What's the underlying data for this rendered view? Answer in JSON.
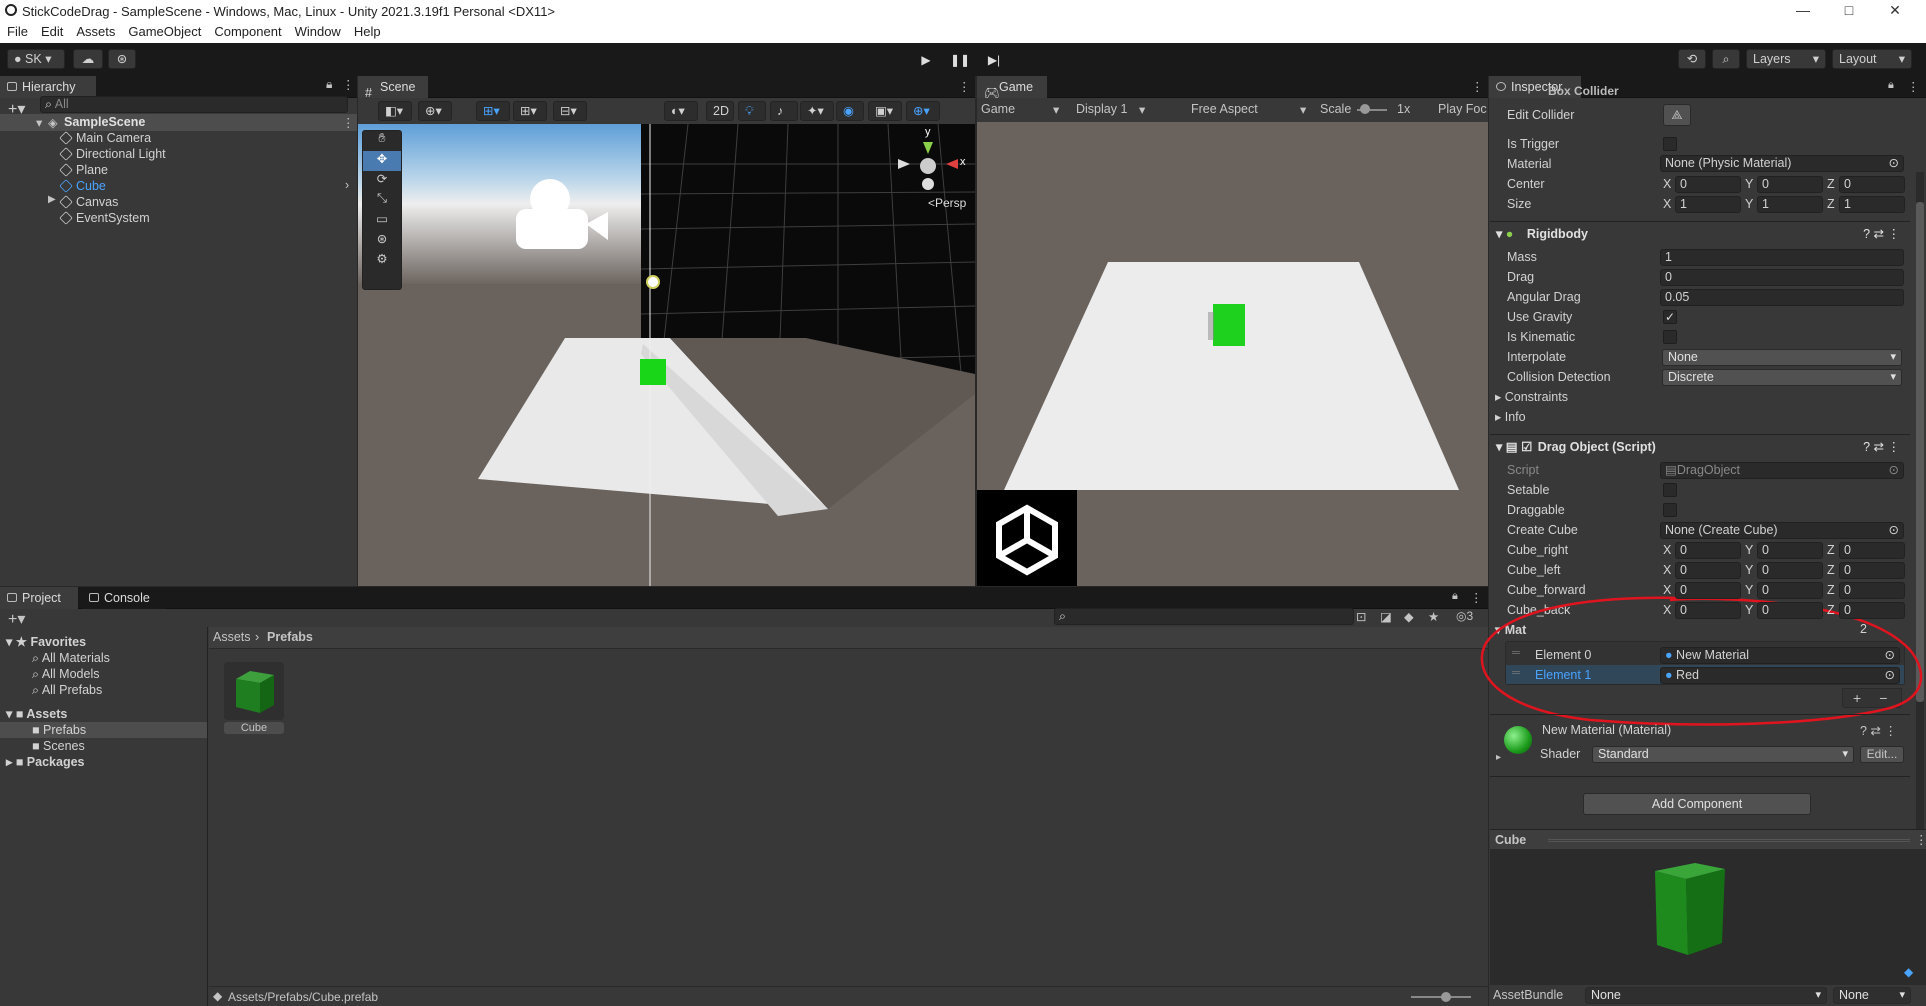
{
  "window": {
    "title": "StickCodeDrag - SampleScene - Windows, Mac, Linux - Unity 2021.3.19f1 Personal <DX11>",
    "minimize": "—",
    "maximize": "□",
    "close": "✕"
  },
  "menu": [
    "File",
    "Edit",
    "Assets",
    "GameObject",
    "Component",
    "Window",
    "Help"
  ],
  "toolbar": {
    "account": "SK",
    "layers": "Layers",
    "layout": "Layout"
  },
  "hierarchy": {
    "tab": "Hierarchy",
    "search_placeholder": "All",
    "scene": "SampleScene",
    "items": [
      "Main Camera",
      "Directional Light",
      "Plane",
      "Cube",
      "Canvas",
      "EventSystem"
    ]
  },
  "scene": {
    "tab": "Scene",
    "mode2d": "2D",
    "persp": "<Persp",
    "gizmo_y": "y",
    "gizmo_x": "x"
  },
  "game": {
    "tab": "Game",
    "display_mode": "Game",
    "display": "Display 1",
    "aspect": "Free Aspect",
    "scale_label": "Scale",
    "scale_value": "1x",
    "play_focused": "Play Foc"
  },
  "project": {
    "tabs": [
      "Project",
      "Console"
    ],
    "favorites": "Favorites",
    "fav_items": [
      "All Materials",
      "All Models",
      "All Prefabs"
    ],
    "assets": "Assets",
    "asset_folders": [
      "Prefabs",
      "Scenes"
    ],
    "packages": "Packages",
    "breadcrumb": [
      "Assets",
      "Prefabs"
    ],
    "files": [
      {
        "name": "Cube"
      }
    ],
    "status_path": "Assets/Prefabs/Cube.prefab",
    "hidden_count": "3"
  },
  "inspector": {
    "tab": "Inspector",
    "box_collider": {
      "header": "Box Collider",
      "edit_collider": "Edit Collider",
      "is_trigger": "Is Trigger",
      "material_label": "Material",
      "material_value": "None (Physic Material)",
      "center_label": "Center",
      "center": [
        "0",
        "0",
        "0"
      ],
      "size_label": "Size",
      "size": [
        "1",
        "1",
        "1"
      ]
    },
    "rigidbody": {
      "header": "Rigidbody",
      "mass_label": "Mass",
      "mass": "1",
      "drag_label": "Drag",
      "drag": "0",
      "angular_drag_label": "Angular Drag",
      "angular_drag": "0.05",
      "use_gravity": "Use Gravity",
      "use_gravity_checked": true,
      "is_kinematic": "Is Kinematic",
      "interpolate_label": "Interpolate",
      "interpolate": "None",
      "collision_label": "Collision Detection",
      "collision": "Discrete",
      "constraints": "Constraints",
      "info": "Info"
    },
    "drag_object": {
      "header": "Drag Object (Script)",
      "script_label": "Script",
      "script": "DragObject",
      "setable": "Setable",
      "draggable": "Draggable",
      "create_cube_label": "Create Cube",
      "create_cube": "None (Create Cube)",
      "cube_right_label": "Cube_right",
      "cube_right": [
        "0",
        "0",
        "0"
      ],
      "cube_left_label": "Cube_left",
      "cube_left": [
        "0",
        "0",
        "0"
      ],
      "cube_forward_label": "Cube_forward",
      "cube_forward": [
        "0",
        "0",
        "0"
      ],
      "cube_back_label": "Cube_back",
      "cube_back": [
        "0",
        "0",
        "0"
      ],
      "mat_label": "Mat",
      "mat_size": "2",
      "elements": [
        {
          "label": "Element 0",
          "value": "New Material"
        },
        {
          "label": "Element 1",
          "value": "Red"
        }
      ]
    },
    "material": {
      "header": "New Material (Material)",
      "shader_label": "Shader",
      "shader": "Standard",
      "edit": "Edit..."
    },
    "add_component": "Add Component",
    "preview_title": "Cube",
    "asset_bundle_label": "AssetBundle",
    "asset_bundle": "None",
    "asset_bundle_variant": "None"
  },
  "axis_labels": {
    "x": "X",
    "y": "Y",
    "z": "Z"
  },
  "colors": {
    "accent": "#4aa3ff",
    "annotation": "#e0141e",
    "cube_green": "#1fd11f"
  }
}
